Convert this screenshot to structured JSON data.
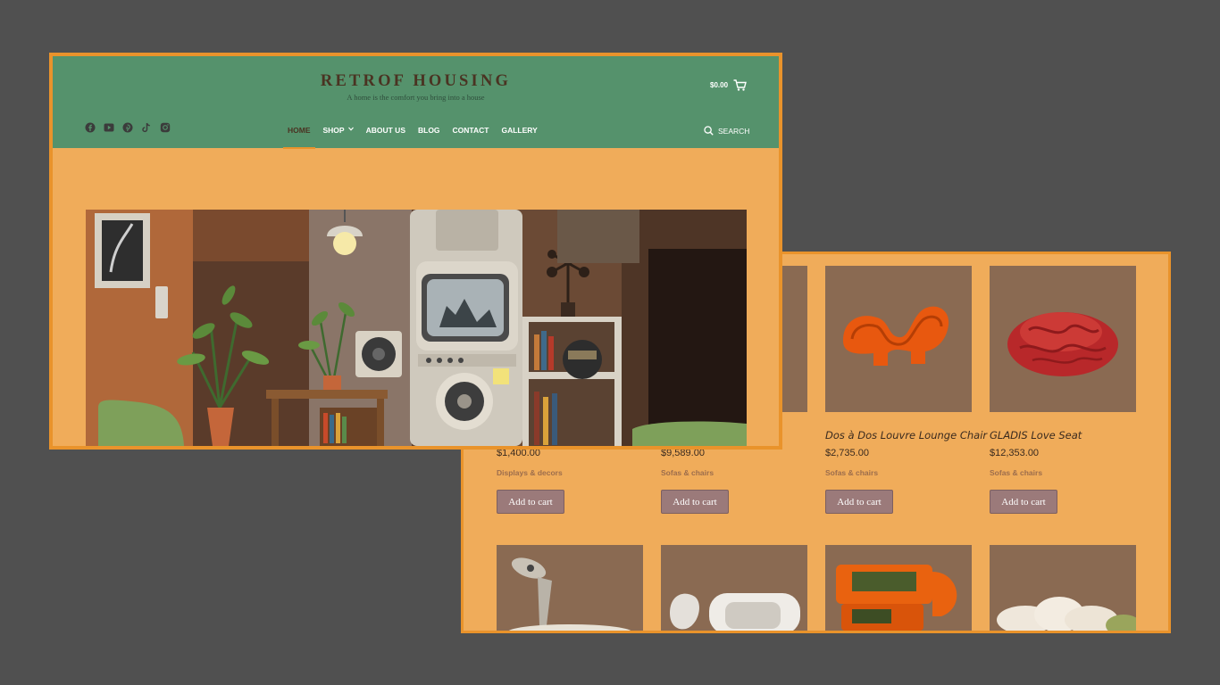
{
  "shop_products": [
    {
      "name": "",
      "price": "$1,400.00",
      "category": "Displays & decors",
      "button": "Add to cart"
    },
    {
      "name": "",
      "price": "$9,589.00",
      "category": "Sofas & chairs",
      "button": "Add to cart"
    },
    {
      "name": "Dos à Dos Louvre Lounge Chair",
      "price": "$2,735.00",
      "category": "Sofas & chairs",
      "button": "Add to cart"
    },
    {
      "name": "GLADIS Love Seat",
      "price": "$12,353.00",
      "category": "Sofas & chairs",
      "button": "Add to cart"
    }
  ],
  "site": {
    "title": "RETROF HOUSING",
    "tagline": "A home is the comfort you bring into a house",
    "cart_total": "$0.00",
    "nav": [
      "HOME",
      "SHOP",
      "ABOUT US",
      "BLOG",
      "CONTACT",
      "GALLERY"
    ],
    "search_label": "SEARCH",
    "socials": [
      "facebook-icon",
      "youtube-icon",
      "pinterest-icon",
      "tiktok-icon",
      "instagram-icon"
    ]
  },
  "colors": {
    "header": "#55926c",
    "page_bg": "#f0ac5a",
    "frame": "#e9932b",
    "button": "#9b7a7a",
    "product_bg": "#8a6a52"
  }
}
